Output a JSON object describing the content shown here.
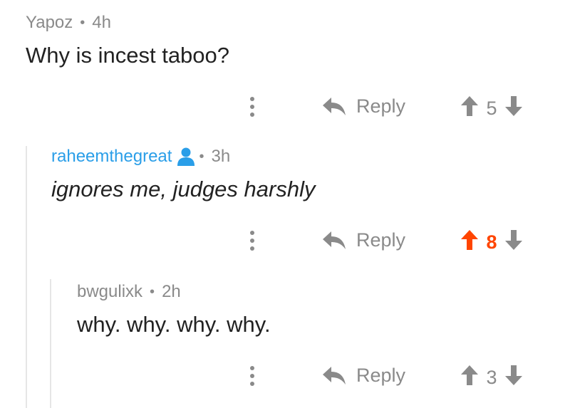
{
  "comments": [
    {
      "author": "Yapoz",
      "separator": "•",
      "age": "4h",
      "text": "Why is incest taboo?",
      "reply_label": "Reply",
      "score": "5",
      "upvoted": false
    },
    {
      "author": "raheemthegreat",
      "separator": "•",
      "age": "3h",
      "text": "ignores me, judges harshly",
      "reply_label": "Reply",
      "score": "8",
      "upvoted": true
    },
    {
      "author": "bwgulixk",
      "separator": "•",
      "age": "2h",
      "text": "why. why. why. why.",
      "reply_label": "Reply",
      "score": "3",
      "upvoted": false
    }
  ],
  "colors": {
    "muted": "#8a8a8a",
    "text": "#222222",
    "op_blue": "#2a9ee8",
    "upvote_orange": "#ff4500",
    "thread_line": "#e6e6e6"
  },
  "icons": {
    "more": "vertical-ellipsis-icon",
    "reply": "reply-arrow-icon",
    "upvote": "up-arrow-icon",
    "downvote": "down-arrow-icon",
    "op_badge": "user-icon"
  }
}
